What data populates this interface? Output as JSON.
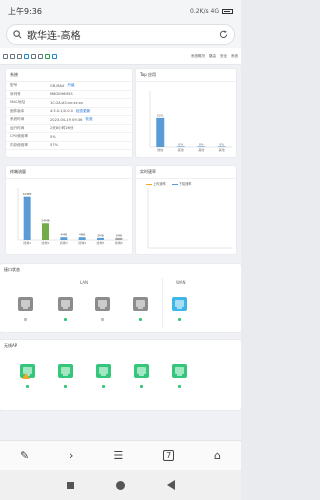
{
  "status": {
    "time": "上午9:36",
    "indicators": "0.2K/s 4G"
  },
  "browser": {
    "page_title": "歌华连-高格"
  },
  "topnav": {
    "items": [
      "系统概况",
      "路由",
      "安全",
      "系统"
    ]
  },
  "info_card": {
    "title": "系统",
    "rows": [
      {
        "key": "型号",
        "value": "GR-MAX",
        "link": "升级"
      },
      {
        "key": "序列号",
        "value": "M8G0H6H5S"
      },
      {
        "key": "MAC地址",
        "value": "1C:2A:A3:xx:xx:xx"
      },
      {
        "key": "固件版本",
        "value": "4.5.0.1/0.0.0",
        "link": "检查更新"
      },
      {
        "key": "系统时间",
        "value": "2023-04-19 09:36",
        "link": "校准"
      },
      {
        "key": "运行时间",
        "value": "2天8小时26分"
      },
      {
        "key": "CPU使用率",
        "value": "5%"
      },
      {
        "key": "内存使用率",
        "value": "57%"
      }
    ]
  },
  "top_card": {
    "title": "Top 应用"
  },
  "traffic_card": {
    "title": "终端流量"
  },
  "rate_card": {
    "title": "实时速率",
    "legend": [
      "上传速率",
      "下载速率"
    ]
  },
  "ports_card": {
    "title": "接口状态",
    "lan_label": "LAN",
    "wan_label": "WAN"
  },
  "ap_card": {
    "title": "无线AP"
  },
  "colors": {
    "accent": "#1d6fd8",
    "bar_blue": "#5b9bd5",
    "bar_green": "#70ad47",
    "port_online": "#34c77b",
    "port_offline": "#8c8c8c",
    "wan": "#3fb6e8",
    "warn": "#f5a623"
  },
  "chart_data": [
    {
      "type": "bar",
      "categories": [
        "微信",
        "其他",
        "其他",
        "其他"
      ],
      "values": [
        52,
        0,
        0,
        0
      ],
      "data_labels": [
        "52%",
        "0%",
        "0%",
        "0%"
      ],
      "ylim": [
        0,
        100
      ]
    },
    {
      "type": "bar",
      "categories": [
        "终端1",
        "终端2",
        "终端3",
        "终端4",
        "终端5",
        "终端6"
      ],
      "values": [
        62,
        24,
        4,
        4,
        3,
        3
      ],
      "data_labels": [
        "62MB",
        "24MB",
        "4MB",
        "4MB",
        "3MB",
        "3MB"
      ]
    }
  ]
}
